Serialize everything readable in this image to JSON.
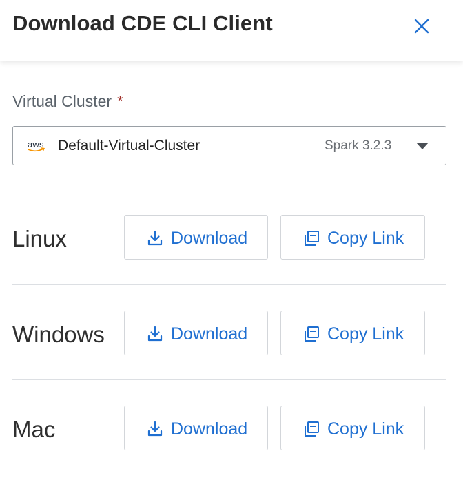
{
  "dialog": {
    "title": "Download CDE CLI Client"
  },
  "field": {
    "label": "Virtual Cluster",
    "required_mark": "*"
  },
  "select": {
    "provider_icon": "aws",
    "value": "Default-Virtual-Cluster",
    "version": "Spark 3.2.3"
  },
  "rows": [
    {
      "os": "Linux",
      "download_label": "Download",
      "copy_label": "Copy Link"
    },
    {
      "os": "Windows",
      "download_label": "Download",
      "copy_label": "Copy Link"
    },
    {
      "os": "Mac",
      "download_label": "Download",
      "copy_label": "Copy Link"
    }
  ],
  "colors": {
    "accent": "#1f6fd1",
    "required": "#a0302a",
    "border": "#d3d6da"
  },
  "icons": {
    "close": "close-icon",
    "download": "download-icon",
    "copy": "copy-icon",
    "dropdown": "caret-down-icon"
  }
}
